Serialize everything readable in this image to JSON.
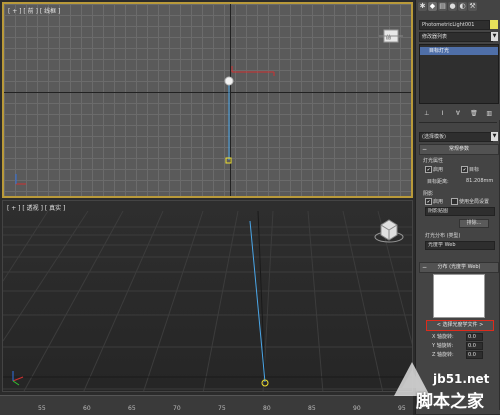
{
  "viewports": {
    "front": {
      "label": "[ + ] [ 前 ] [ 线框 ]"
    },
    "perspective": {
      "label": "[ + ] [ 透视 ] [ 真实 ]"
    }
  },
  "ruler": {
    "ticks": [
      "55",
      "60",
      "65",
      "70",
      "75",
      "80",
      "85",
      "90",
      "95"
    ]
  },
  "command_panel": {
    "object_name": "PhotometricLight001",
    "modifier_list": "修改器列表",
    "stack_item": "目标灯光",
    "shadow_select": "(选择模板)",
    "general_params": {
      "title": "常规参数",
      "light_props": "灯光属性",
      "enabled": "启用",
      "targeted": "目标",
      "target_distance_label": "目标距离:",
      "target_distance_value": "81.208mm",
      "shadows": "阴影",
      "shadows_enabled": "启用",
      "use_global": "使用全局设置",
      "shadow_type": "阴影贴图",
      "exclude_button": "排除...",
      "distribution_label": "灯光分布 (类型)",
      "distribution_value": "光度学 Web"
    },
    "web_rollout": {
      "title": "分布 (光度学 Web)",
      "choose_file_button": "< 选择光度学文件 >",
      "x_rotation_label": "X 轴旋转:",
      "x_rotation_value": "0.0",
      "y_rotation_label": "Y 轴旋转:",
      "y_rotation_value": "0.0",
      "z_rotation_label": "Z 轴旋转:",
      "z_rotation_value": "0.0"
    }
  },
  "watermark": {
    "line1": "jb51.net",
    "line2": "脚本之家"
  }
}
